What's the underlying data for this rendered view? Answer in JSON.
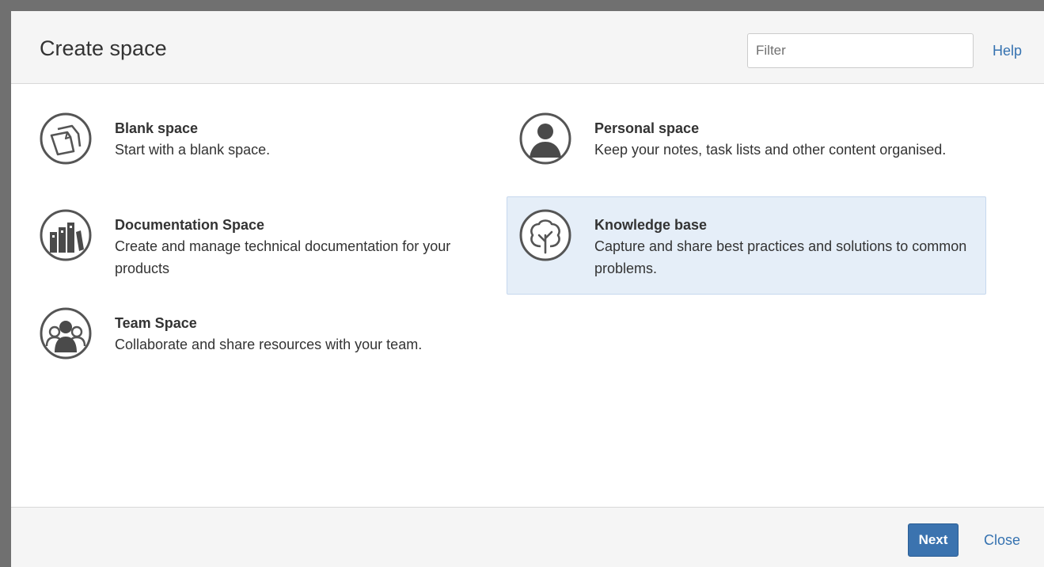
{
  "dialog": {
    "title": "Create space",
    "filter_placeholder": "Filter",
    "help_label": "Help"
  },
  "templates": [
    {
      "name": "Blank space",
      "description": "Start with a blank space.",
      "icon": "blank-page-icon"
    },
    {
      "name": "Personal space",
      "description": "Keep your notes, task lists and other content organised.",
      "icon": "person-icon"
    },
    {
      "name": "Documentation Space",
      "description": "Create and manage technical documentation for your products",
      "icon": "books-icon"
    },
    {
      "name": "Knowledge base",
      "description": "Capture and share best practices and solutions to common problems.",
      "icon": "tree-icon",
      "selected": true
    },
    {
      "name": "Team Space",
      "description": "Collaborate and share resources with your team.",
      "icon": "team-icon"
    }
  ],
  "footer": {
    "next_label": "Next",
    "close_label": "Close"
  },
  "colors": {
    "accent": "#3b73af",
    "link": "#3572b0",
    "selected_bg": "#e5eef8"
  }
}
